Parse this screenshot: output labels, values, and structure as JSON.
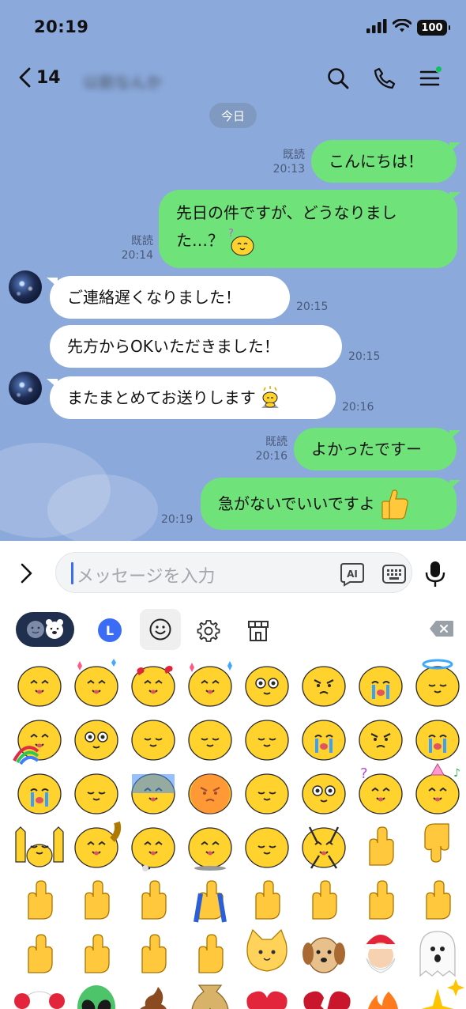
{
  "status_bar": {
    "time": "20:19",
    "battery": "100"
  },
  "header": {
    "back_count": "14",
    "chat_name": "以前なんか"
  },
  "date_divider": "今日",
  "messages": [
    {
      "id": "m1",
      "side": "out",
      "text": "こんにちは！",
      "read": "既読",
      "time": "20:13"
    },
    {
      "id": "m2",
      "side": "out",
      "line1": "先日の件ですが、どうなりまし",
      "line2": "た…？",
      "read": "既読",
      "time": "20:14"
    },
    {
      "id": "m3",
      "side": "in",
      "text": "ご連絡遅くなりました！",
      "time": "20:15"
    },
    {
      "id": "m4",
      "side": "in",
      "text": "先方からOKいただきました！",
      "time": "20:15"
    },
    {
      "id": "m5",
      "side": "in",
      "text": "またまとめてお送りします",
      "time": "20:16"
    },
    {
      "id": "m6",
      "side": "out",
      "text": "よかったですー",
      "read": "既読",
      "time": "20:16"
    },
    {
      "id": "m7",
      "side": "out",
      "text": "急がないでいいですよ",
      "time": "20:19"
    }
  ],
  "input": {
    "placeholder": "メッセージを入力",
    "ai_label": "AI"
  },
  "keyboard": {
    "tabs": [
      "emoji-set-tab",
      "recent-tab",
      "emoji-tab",
      "settings-tab",
      "shop-tab"
    ],
    "recent_letter": "L",
    "rows": [
      [
        "thumbs-up",
        "grateful-sparkle",
        "heart-eyes",
        "excited-sparkle",
        "sparkle-sunglasses",
        "thinking",
        "crying",
        "angel"
      ],
      [
        "rainbow",
        "big-eyes",
        "shy",
        "melting",
        "melted",
        "worried-sweat",
        "smirk",
        "crying-sweat"
      ],
      [
        "sobbing",
        "sleepy-flat",
        "cold-blue",
        "angry-red",
        "peeking",
        "shocked",
        "question",
        "party-music"
      ],
      [
        "hands-up",
        "flexing-blob",
        "running",
        "dashing",
        "lying-down",
        "arms-up",
        "thumbs-up-hand",
        "thumbs-down-hand"
      ],
      [
        "crossed-fingers",
        "victory-hand",
        "waving-hand",
        "folded-hands",
        "flexed-biceps",
        "heart-hands",
        "pointing-right",
        "pointing-left"
      ],
      [
        "rock-on",
        "ok-hand",
        "fist",
        "finger-heart",
        "cat-face",
        "dog-face",
        "santa",
        "ghost"
      ],
      [
        "clown",
        "alien",
        "poop",
        "money-bag",
        "red-heart",
        "broken-heart",
        "fire",
        "sparkles"
      ]
    ]
  },
  "colors": {
    "chat_background": "#8BA9DB",
    "outgoing_bubble": "#6FE37A",
    "incoming_bubble": "#FFFFFF",
    "emoji_yellow": "#FFD22E",
    "notification_dot": "#06C755"
  }
}
